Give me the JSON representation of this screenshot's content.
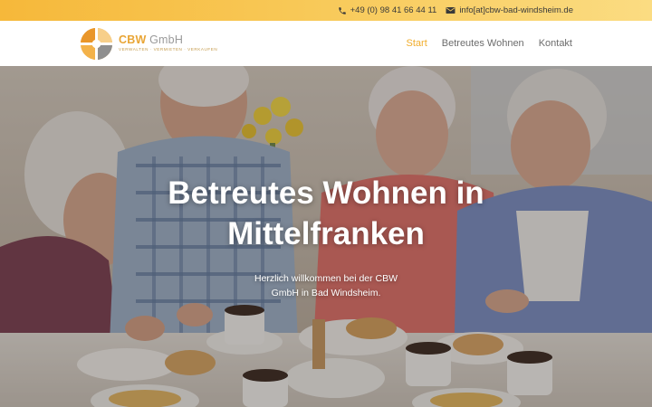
{
  "topbar": {
    "phone": "+49 (0) 98 41 66 44 11",
    "email": "info[at]cbw-bad-windsheim.de",
    "phone_icon": "phone-icon",
    "email_icon": "envelope-icon"
  },
  "header": {
    "logo": {
      "name_bold": "CBW",
      "name_rest": " GmbH",
      "tagline": "VERWALTEN · VERMIETEN · VERKAUFEN"
    },
    "nav": [
      {
        "label": "Start",
        "active": true
      },
      {
        "label": "Betreutes Wohnen",
        "active": false
      },
      {
        "label": "Kontakt",
        "active": false
      }
    ]
  },
  "hero": {
    "title": "Betreutes Wohnen in Mittelfranken",
    "subtitle": "Herzlich willkommen bei der CBW GmbH in Bad Windsheim."
  },
  "colors": {
    "accent": "#f1ad2c",
    "topbar_start": "#f6b83a",
    "topbar_end": "#fbdc82",
    "nav_text": "#6c6c6c"
  }
}
